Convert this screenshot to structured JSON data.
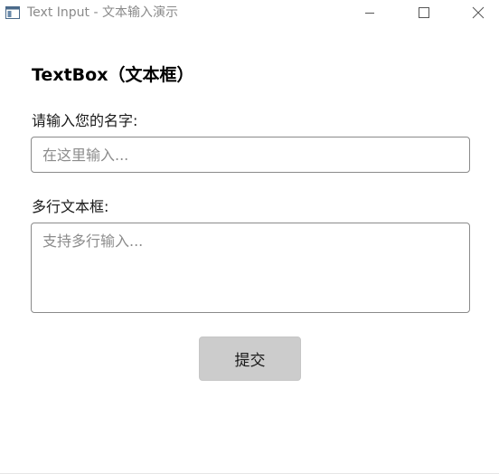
{
  "window": {
    "title": "Text Input - 文本输入演示",
    "app_icon": "app-window-icon",
    "controls": {
      "minimize_icon": "minimize-icon",
      "maximize_icon": "maximize-icon",
      "close_icon": "close-icon"
    }
  },
  "main": {
    "heading": "TextBox（文本框）",
    "name_field": {
      "label": "请输入您的名字:",
      "placeholder": "在这里输入...",
      "value": ""
    },
    "multiline_field": {
      "label": "多行文本框:",
      "placeholder": "支持多行输入...",
      "value": ""
    },
    "submit_label": "提交"
  },
  "colors": {
    "title_text": "#8a8a8a",
    "border": "#8a8a8a",
    "placeholder": "#8c8c8c",
    "button_bg": "#cccccc"
  }
}
